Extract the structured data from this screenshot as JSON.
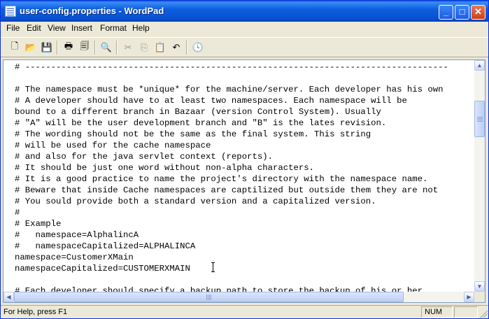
{
  "window": {
    "title": "user-config.properties - WordPad"
  },
  "title_buttons": {
    "minimize": "_",
    "maximize": "□",
    "close": "✕"
  },
  "menu": [
    "File",
    "Edit",
    "View",
    "Insert",
    "Format",
    "Help"
  ],
  "toolbar": [
    {
      "name": "new-document-icon",
      "glyph": "🗋"
    },
    {
      "name": "open-folder-icon",
      "glyph": "📂"
    },
    {
      "name": "save-icon",
      "glyph": "💾"
    },
    {
      "name": "print-icon",
      "glyph": "🖶"
    },
    {
      "name": "print-preview-icon",
      "glyph": "🗐"
    },
    {
      "name": "find-binoculars-icon",
      "glyph": "🔍"
    },
    {
      "name": "cut-icon",
      "glyph": "✂"
    },
    {
      "name": "copy-icon",
      "glyph": "⎘"
    },
    {
      "name": "paste-icon",
      "glyph": "📋"
    },
    {
      "name": "undo-icon",
      "glyph": "↶"
    },
    {
      "name": "insert-date-time-icon",
      "glyph": "🕓"
    }
  ],
  "document_lines": [
    "# ----------------------------------------------------------------------------------",
    "",
    "# The namespace must be *unique* for the machine/server. Each developer has his own",
    "# A developer should have to at least two namespaces. Each namespace will be",
    "bound to a different branch in Bazaar (version Control System). Usually",
    "# \"A\" will be the user development branch and \"B\" is the lates revision.",
    "# The wording should not be the same as the final system. This string",
    "# will be used for the cache namespace",
    "# and also for the java servlet context (reports).",
    "# It should be just one word without non-alpha characters.",
    "# It is a good practice to name the project's directory with the namespace name.",
    "# Beware that inside Cache namespaces are captilized but outside them they are not",
    "# You sould provide both a standard version and a capitalized version.",
    "#",
    "# Example",
    "#   namespace=AlphalincA",
    "#   namespaceCapitalized=ALPHALINCA",
    "namespace=CustomerXMain",
    "namespaceCapitalized=CUSTOMERXMAIN",
    "",
    "# Each developer should specify a backup path to store the backup of his or her"
  ],
  "status": {
    "help": "For Help, press F1",
    "num": "NUM"
  }
}
